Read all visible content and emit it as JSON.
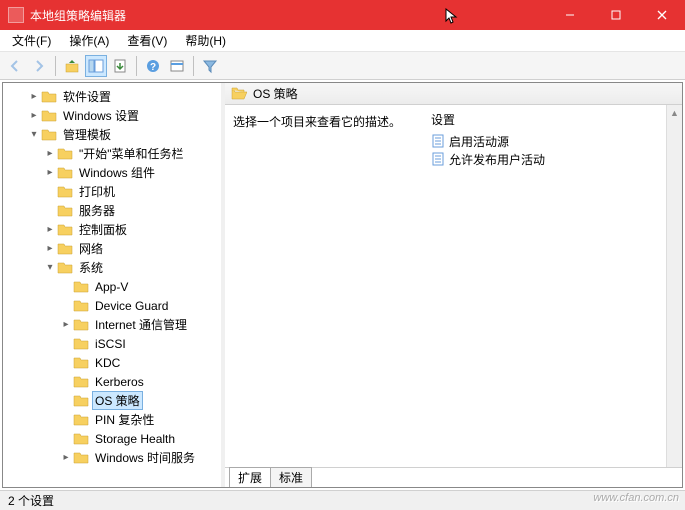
{
  "window": {
    "title": "本地组策略编辑器"
  },
  "menu": {
    "file": "文件(F)",
    "action": "操作(A)",
    "view": "查看(V)",
    "help": "帮助(H)"
  },
  "tree": {
    "items": [
      {
        "depth": 1,
        "exp": "closed",
        "label": "软件设置"
      },
      {
        "depth": 1,
        "exp": "closed",
        "label": "Windows 设置"
      },
      {
        "depth": 1,
        "exp": "open",
        "label": "管理模板"
      },
      {
        "depth": 2,
        "exp": "closed",
        "label": "\"开始\"菜单和任务栏"
      },
      {
        "depth": 2,
        "exp": "closed",
        "label": "Windows 组件"
      },
      {
        "depth": 2,
        "exp": "none",
        "label": "打印机"
      },
      {
        "depth": 2,
        "exp": "none",
        "label": "服务器"
      },
      {
        "depth": 2,
        "exp": "closed",
        "label": "控制面板"
      },
      {
        "depth": 2,
        "exp": "closed",
        "label": "网络"
      },
      {
        "depth": 2,
        "exp": "open",
        "label": "系统"
      },
      {
        "depth": 3,
        "exp": "none",
        "label": "App-V"
      },
      {
        "depth": 3,
        "exp": "none",
        "label": "Device Guard"
      },
      {
        "depth": 3,
        "exp": "closed",
        "label": "Internet 通信管理"
      },
      {
        "depth": 3,
        "exp": "none",
        "label": "iSCSI"
      },
      {
        "depth": 3,
        "exp": "none",
        "label": "KDC"
      },
      {
        "depth": 3,
        "exp": "none",
        "label": "Kerberos"
      },
      {
        "depth": 3,
        "exp": "none",
        "label": "OS 策略",
        "selected": true
      },
      {
        "depth": 3,
        "exp": "none",
        "label": "PIN 复杂性"
      },
      {
        "depth": 3,
        "exp": "none",
        "label": "Storage Health"
      },
      {
        "depth": 3,
        "exp": "closed",
        "label": "Windows 时间服务"
      }
    ]
  },
  "content": {
    "header": "OS 策略",
    "desc_prompt": "选择一个项目来查看它的描述。",
    "settings_header": "设置",
    "settings": [
      {
        "label": "启用活动源"
      },
      {
        "label": "允许发布用户活动"
      }
    ]
  },
  "tabs": {
    "extended": "扩展",
    "standard": "标准"
  },
  "status": {
    "text": "2 个设置"
  },
  "watermark": "www.cfan.com.cn"
}
